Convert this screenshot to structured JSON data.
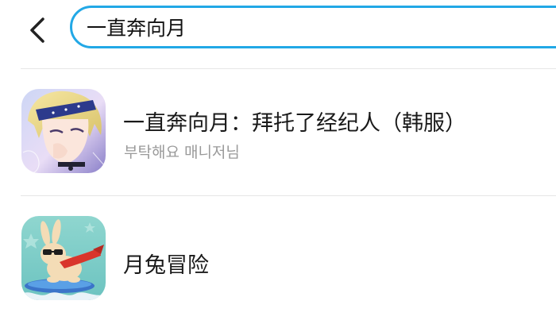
{
  "header": {
    "back_icon": "chevron-left-icon",
    "search": {
      "value": "一直奔向月",
      "border_color": "#22a8e6"
    }
  },
  "results": [
    {
      "title": "一直奔向月：拜托了经纪人（韩服）",
      "subtitle": "부탁해요 매니저님",
      "icon": "anime-character-icon"
    },
    {
      "title": "月兔冒险",
      "icon": "rabbit-surfing-icon"
    }
  ]
}
